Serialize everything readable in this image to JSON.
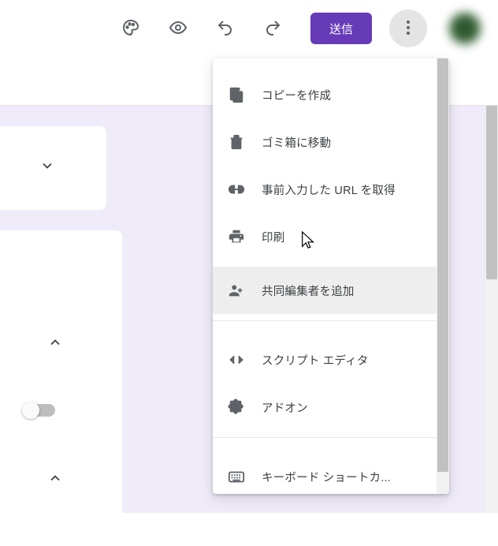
{
  "toolbar": {
    "send_label": "送信"
  },
  "menu": {
    "items": [
      {
        "icon": "copy-icon",
        "label": "コピーを作成"
      },
      {
        "icon": "trash-icon",
        "label": "ゴミ箱に移動"
      },
      {
        "icon": "link-icon",
        "label": "事前入力した URL を取得"
      },
      {
        "icon": "print-icon",
        "label": "印刷"
      },
      {
        "icon": "add-collaborator-icon",
        "label": "共同編集者を追加",
        "hovered": true
      },
      {
        "icon": "code-icon",
        "label": "スクリプト エディタ",
        "sep_before": true
      },
      {
        "icon": "addon-icon",
        "label": "アドオン"
      },
      {
        "icon": "keyboard-icon",
        "label": "キーボード ショートカ...",
        "sep_before": true
      }
    ]
  },
  "colors": {
    "accent": "#673ab7",
    "canvas_bg": "#f0ebf8"
  }
}
